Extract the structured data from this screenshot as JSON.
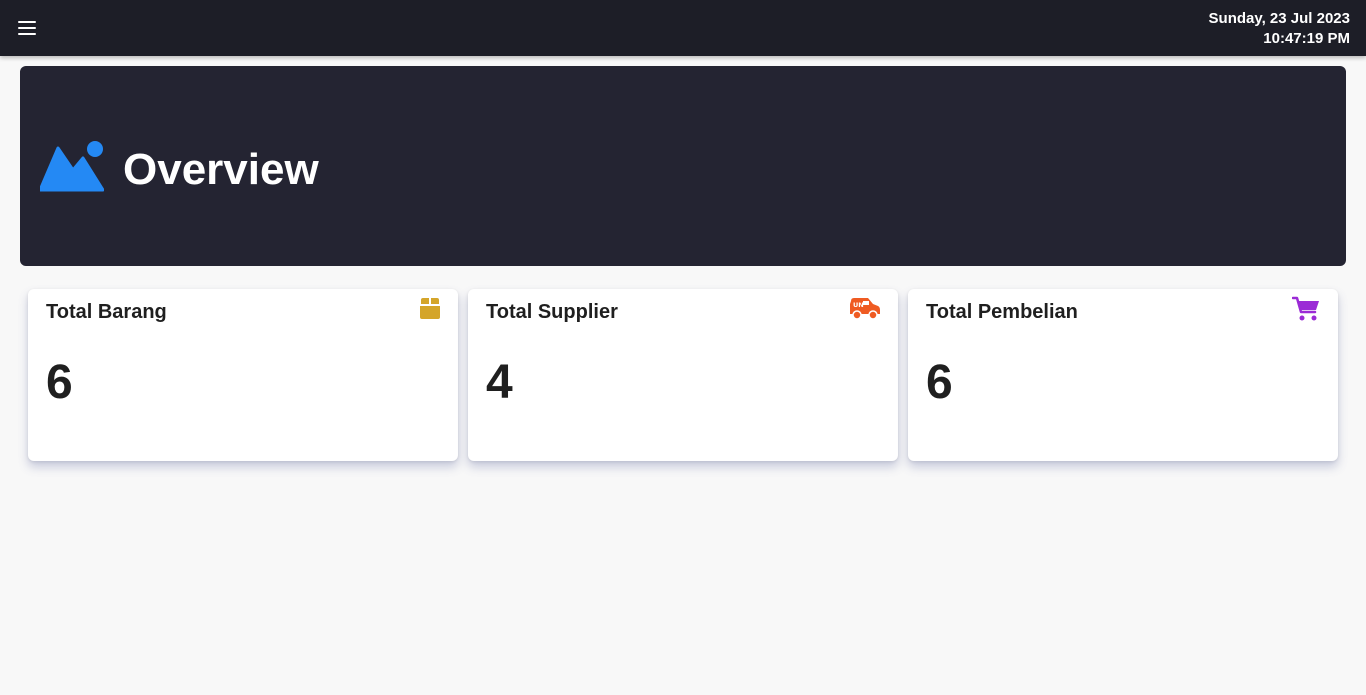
{
  "header": {
    "menu_icon": "hamburger-menu-icon",
    "date": "Sunday, 23 Jul 2023",
    "time": "10:47:19 PM",
    "background": "#1d1e27"
  },
  "banner": {
    "icon": "mountain-image-icon",
    "title": "Overview",
    "icon_color": "#2489f4",
    "background": "#242432"
  },
  "cards": [
    {
      "title": "Total Barang",
      "value": "6",
      "icon": "box-icon",
      "icon_color": "#d4a52a"
    },
    {
      "title": "Total Supplier",
      "value": "4",
      "icon": "delivery-truck-icon",
      "icon_color": "#ef5b22"
    },
    {
      "title": "Total Pembelian",
      "value": "6",
      "icon": "shopping-cart-icon",
      "icon_color": "#9b2bd6"
    }
  ]
}
